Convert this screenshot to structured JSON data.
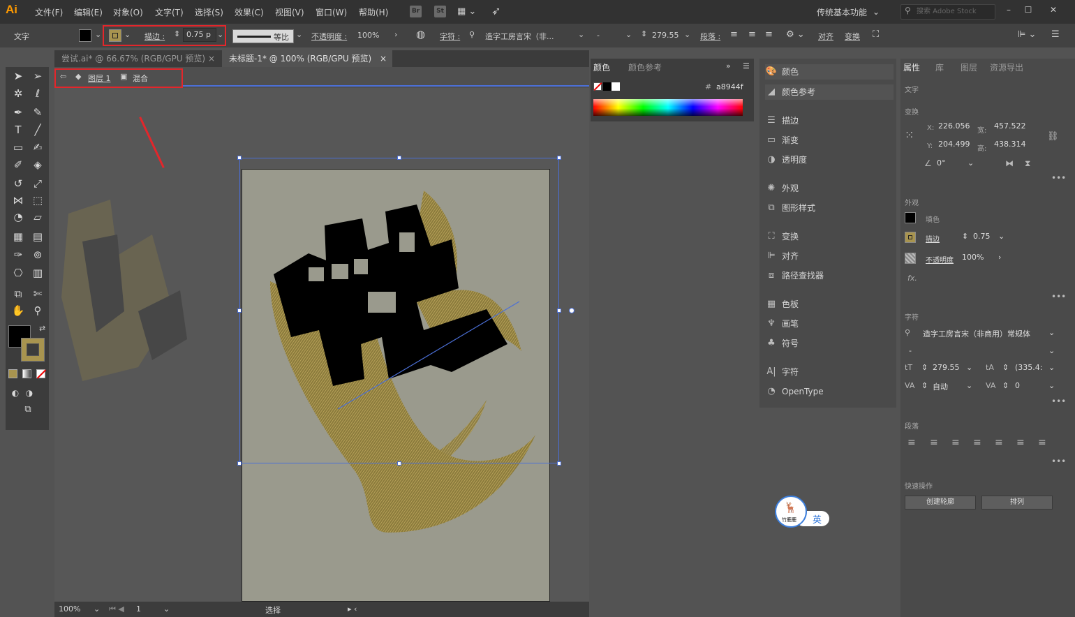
{
  "app": {
    "logo": "Ai"
  },
  "menu": [
    "文件(F)",
    "编辑(E)",
    "对象(O)",
    "文字(T)",
    "选择(S)",
    "效果(C)",
    "视图(V)",
    "窗口(W)",
    "帮助(H)"
  ],
  "menu_buttons": [
    "Br",
    "St"
  ],
  "workspace": "传统基本功能",
  "search_placeholder": "搜索 Adobe Stock",
  "control": {
    "type_label": "文字",
    "stroke_label": "描边 :",
    "stroke_value": "0.75 p",
    "profile_label": "等比",
    "opacity_label": "不透明度 :",
    "opacity_value": "100%",
    "char_label": "字符 :",
    "font_name": "造字工房言宋（非...",
    "font_style": "-",
    "font_size": "279.55",
    "para_label": "段落 :",
    "align_label": "对齐",
    "transform_label": "变换"
  },
  "tabs": [
    {
      "label": "尝试.ai* @ 66.67% (RGB/GPU 预览)",
      "active": false
    },
    {
      "label": "未标题-1* @ 100% (RGB/GPU 预览)",
      "active": true
    }
  ],
  "isolation": {
    "layer": "图层 1",
    "group": "混合"
  },
  "status": {
    "zoom": "100%",
    "page": "1",
    "tool": "选择"
  },
  "color_panel": {
    "tab_color": "颜色",
    "tab_guide": "颜色参考",
    "hex": "a8944f"
  },
  "mid_panel": [
    {
      "icon": "color-icon",
      "label": "颜色"
    },
    {
      "icon": "color-guide-icon",
      "label": "颜色参考"
    },
    {
      "icon": "stroke-icon",
      "label": "描边"
    },
    {
      "icon": "gradient-icon",
      "label": "渐变"
    },
    {
      "icon": "transparency-icon",
      "label": "透明度"
    },
    {
      "icon": "appearance-icon",
      "label": "外观"
    },
    {
      "icon": "graphic-styles-icon",
      "label": "图形样式"
    },
    {
      "icon": "transform-icon",
      "label": "变换"
    },
    {
      "icon": "align-icon",
      "label": "对齐"
    },
    {
      "icon": "pathfinder-icon",
      "label": "路径查找器"
    },
    {
      "icon": "swatches-icon",
      "label": "色板"
    },
    {
      "icon": "brushes-icon",
      "label": "画笔"
    },
    {
      "icon": "symbols-icon",
      "label": "符号"
    },
    {
      "icon": "character-icon",
      "label": "字符"
    },
    {
      "icon": "opentype-icon",
      "label": "OpenType"
    }
  ],
  "props": {
    "tabs": [
      "属性",
      "库",
      "图层",
      "资源导出"
    ],
    "section_text": "文字",
    "section_transform": "变换",
    "x": "226.056",
    "y": "204.499",
    "w": "457.522",
    "h": "438.314",
    "x_label": "X:",
    "y_label": "Y:",
    "w_label": "宽:",
    "h_label": "高:",
    "angle": "0°",
    "section_appearance": "外观",
    "fill_label": "填色",
    "stroke_label": "描边",
    "stroke_value": "0.75",
    "opacity_label": "不透明度",
    "opacity_value": "100%",
    "fx": "fx.",
    "section_char": "字符",
    "font": "造字工房言宋（非商用）常规体",
    "style": "-",
    "size": "279.55",
    "leading": "(335.4:",
    "kerning": "自动",
    "tracking": "0",
    "section_para": "段落",
    "section_quick": "快速操作",
    "btn_outline": "创建轮廓",
    "btn_arrange": "排列"
  },
  "ime": {
    "lang": "英",
    "caption": "竹鹿鹿"
  },
  "colors": {
    "accent_gold": "#a8944f",
    "selection": "#4b6fd6",
    "highlight_red": "#e3262b"
  }
}
